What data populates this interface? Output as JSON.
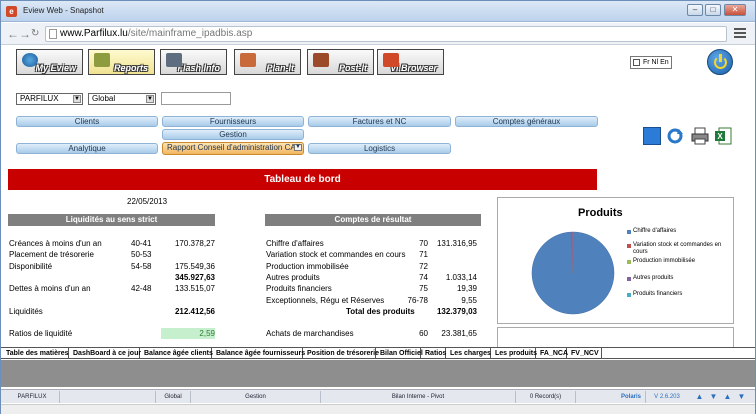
{
  "window": {
    "title": "Eview Web - Snapshot"
  },
  "browser": {
    "url_domain": "www.Parfilux.lu",
    "url_path": "/site/mainframe_ipadbis.asp"
  },
  "toolbar": {
    "buttons": [
      {
        "label": "My Eview"
      },
      {
        "label": "Reports"
      },
      {
        "label": "Flash Info"
      },
      {
        "label": "Plan-It"
      },
      {
        "label": "Post-It"
      },
      {
        "label": "Vi.Browser"
      }
    ],
    "lang_label": "Fr Nl En"
  },
  "selectors": {
    "company": "PARFILUX",
    "scope": "Global"
  },
  "nav": {
    "clients": "Clients",
    "fournisseurs": "Fournisseurs",
    "factures": "Factures et NC",
    "comptes": "Comptes généraux",
    "gestion": "Gestion",
    "analytique": "Analytique",
    "rapport": "Rapport Conseil d'administration CA",
    "logistics": "Logistics"
  },
  "report": {
    "banner": "Tableau de bord",
    "date": "22/05/2013",
    "left_header": "Liquidités au sens strict",
    "left_rows": [
      {
        "label": "Créances à moins d'un an",
        "code": "40-41",
        "value": "170.378,27"
      },
      {
        "label": "Placement de trésorerie",
        "code": "50-53",
        "value": ""
      },
      {
        "label": "Disponibilité",
        "code": "54-58",
        "value": "175.549,36"
      },
      {
        "label": "",
        "code": "",
        "value": "345.927,63"
      },
      {
        "label": "Dettes à moins d'un an",
        "code": "42-48",
        "value": "133.515,07"
      },
      {
        "label": "",
        "code": "",
        "value": ""
      },
      {
        "label": "Liquidités",
        "code": "",
        "value": "212.412,56"
      },
      {
        "label": "",
        "code": "",
        "value": ""
      },
      {
        "label": "Ratios de liquidité",
        "code": "",
        "value": "2,59"
      }
    ],
    "right_header": "Comptes de résultat",
    "right_rows": [
      {
        "label": "Chiffre d'affaires",
        "code": "70",
        "value": "131.316,95"
      },
      {
        "label": "Variation stock et commandes en cours",
        "code": "71",
        "value": ""
      },
      {
        "label": "Production immobilisée",
        "code": "72",
        "value": ""
      },
      {
        "label": "Autres produits",
        "code": "74",
        "value": "1.033,14"
      },
      {
        "label": "Produits financiers",
        "code": "75",
        "value": "19,39"
      },
      {
        "label": "Exceptionnels, Régu et Réserves",
        "code": "76-78",
        "value": "9,55"
      },
      {
        "label": "Total des produits",
        "code": "",
        "value": "132.379,03"
      },
      {
        "label": "",
        "code": "",
        "value": ""
      },
      {
        "label": "Achats de marchandises",
        "code": "60",
        "value": "23.381,65"
      }
    ]
  },
  "chart_data": {
    "type": "pie",
    "title": "Produits",
    "categories": [
      "Chiffre d'affaires",
      "Variation stock et commandes en cours",
      "Production immobilisée",
      "Autres produits",
      "Produits financiers"
    ],
    "values": [
      131316.95,
      0,
      0,
      1033.14,
      19.39
    ],
    "colors": [
      "#4f81bd",
      "#c0504d",
      "#9bbb59",
      "#8064a2",
      "#4bacc6"
    ],
    "legend": "right"
  },
  "bottom_tabs": [
    "Table des matières",
    "DashBoard à ce jour",
    "Balance âgée clients",
    "Balance âgée fournisseurs",
    "Position de trésorerie",
    "Bilan Officiel",
    "Ratios",
    "Les charges",
    "Les produits",
    "FA_NCA",
    "FV_NCV"
  ],
  "status": {
    "company": "PARFILUX",
    "scope": "Global",
    "module": "Gestion",
    "report": "Bilan Interne - Pivot",
    "records": "0 Record(s)",
    "brand": "Polaris",
    "version": "V 2.6.203"
  }
}
